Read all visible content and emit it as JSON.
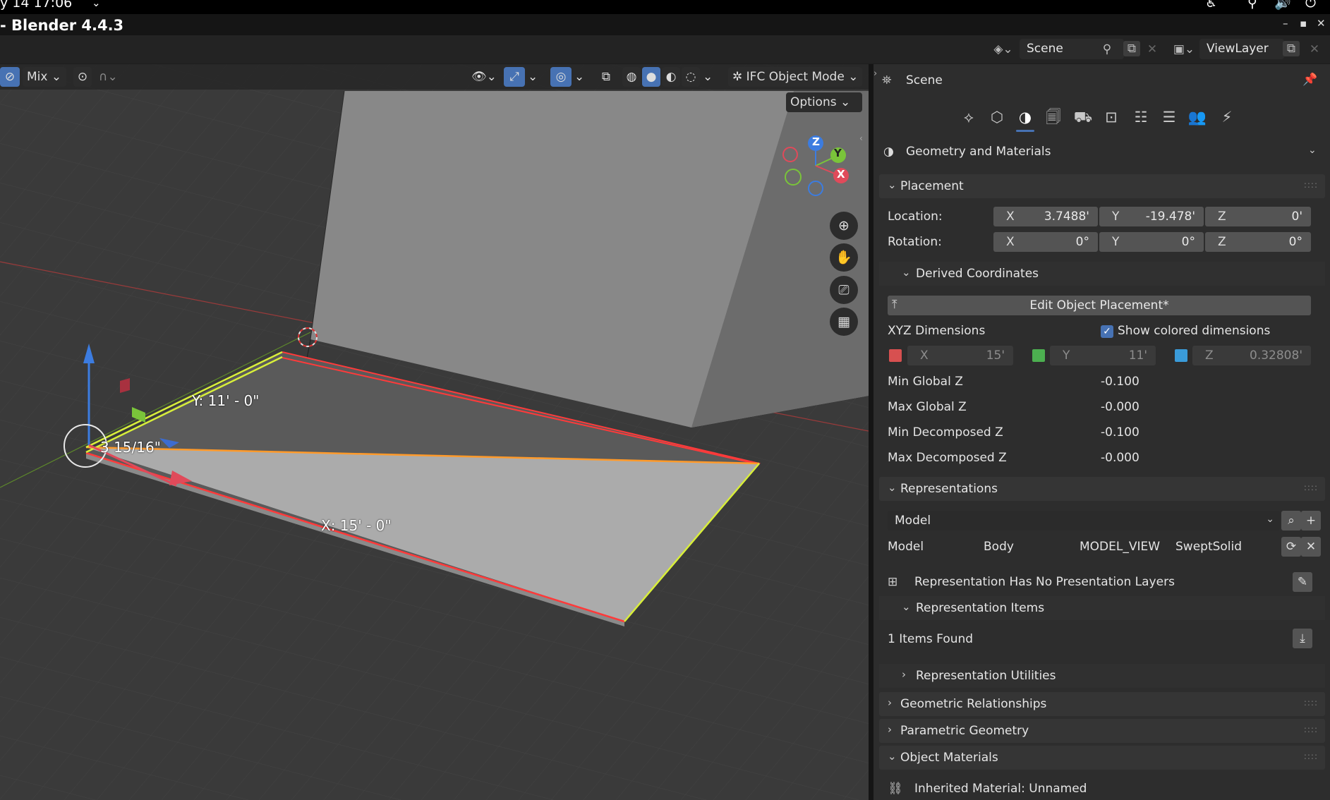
{
  "os_bar": {
    "clock": "y 14  17:06"
  },
  "window": {
    "title": "- Blender 4.4.3"
  },
  "topbar": {
    "scene_name": "Scene",
    "view_layer": "ViewLayer"
  },
  "viewport": {
    "header": {
      "snap_mode": "Mix",
      "mode": "IFC Object Mode",
      "options_label": "Options"
    },
    "gizmo": {
      "z": "Z",
      "y": "Y",
      "x": "X"
    },
    "dimensions": {
      "y_label": "Y: 11' - 0\"",
      "x_label": "X: 15' - 0\"",
      "z_label": "3 15/16\""
    }
  },
  "properties": {
    "breadcrumb": "Scene",
    "category": "Geometry and Materials",
    "placement": {
      "title": "Placement",
      "location_label": "Location:",
      "rotation_label": "Rotation:",
      "location": {
        "x": "3.7488'",
        "y": "-19.478'",
        "z": "0'"
      },
      "rotation": {
        "x": "0°",
        "y": "0°",
        "z": "0°"
      },
      "axis_x": "X",
      "axis_y": "Y",
      "axis_z": "Z"
    },
    "derived": {
      "title": "Derived Coordinates",
      "edit_button": "Edit Object Placement*",
      "xyz_dimensions": "XYZ Dimensions",
      "show_colored": "Show colored dimensions",
      "dims": {
        "x": "15'",
        "y": "11'",
        "z": "0.32808'"
      },
      "colors": {
        "x": "#d75050",
        "y": "#4caf50",
        "z": "#3a9bd9"
      },
      "min_global_z_label": "Min Global Z",
      "min_global_z": "-0.100",
      "max_global_z_label": "Max Global Z",
      "max_global_z": "-0.000",
      "min_decomposed_z_label": "Min Decomposed Z",
      "min_decomposed_z": "-0.100",
      "max_decomposed_z_label": "Max Decomposed Z",
      "max_decomposed_z": "-0.000"
    },
    "representations": {
      "title": "Representations",
      "context_select": "Model",
      "row": {
        "context": "Model",
        "identifier": "Body",
        "target_view": "MODEL_VIEW",
        "type": "SweptSolid"
      },
      "no_layers": "Representation Has No Presentation Layers",
      "items_title": "Representation Items",
      "items_found": "1 Items Found",
      "utilities_title": "Representation Utilities"
    },
    "geometric_relationships": "Geometric Relationships",
    "parametric_geometry": "Parametric Geometry",
    "object_materials": {
      "title": "Object Materials",
      "inherited": "Inherited Material: Unnamed"
    }
  }
}
